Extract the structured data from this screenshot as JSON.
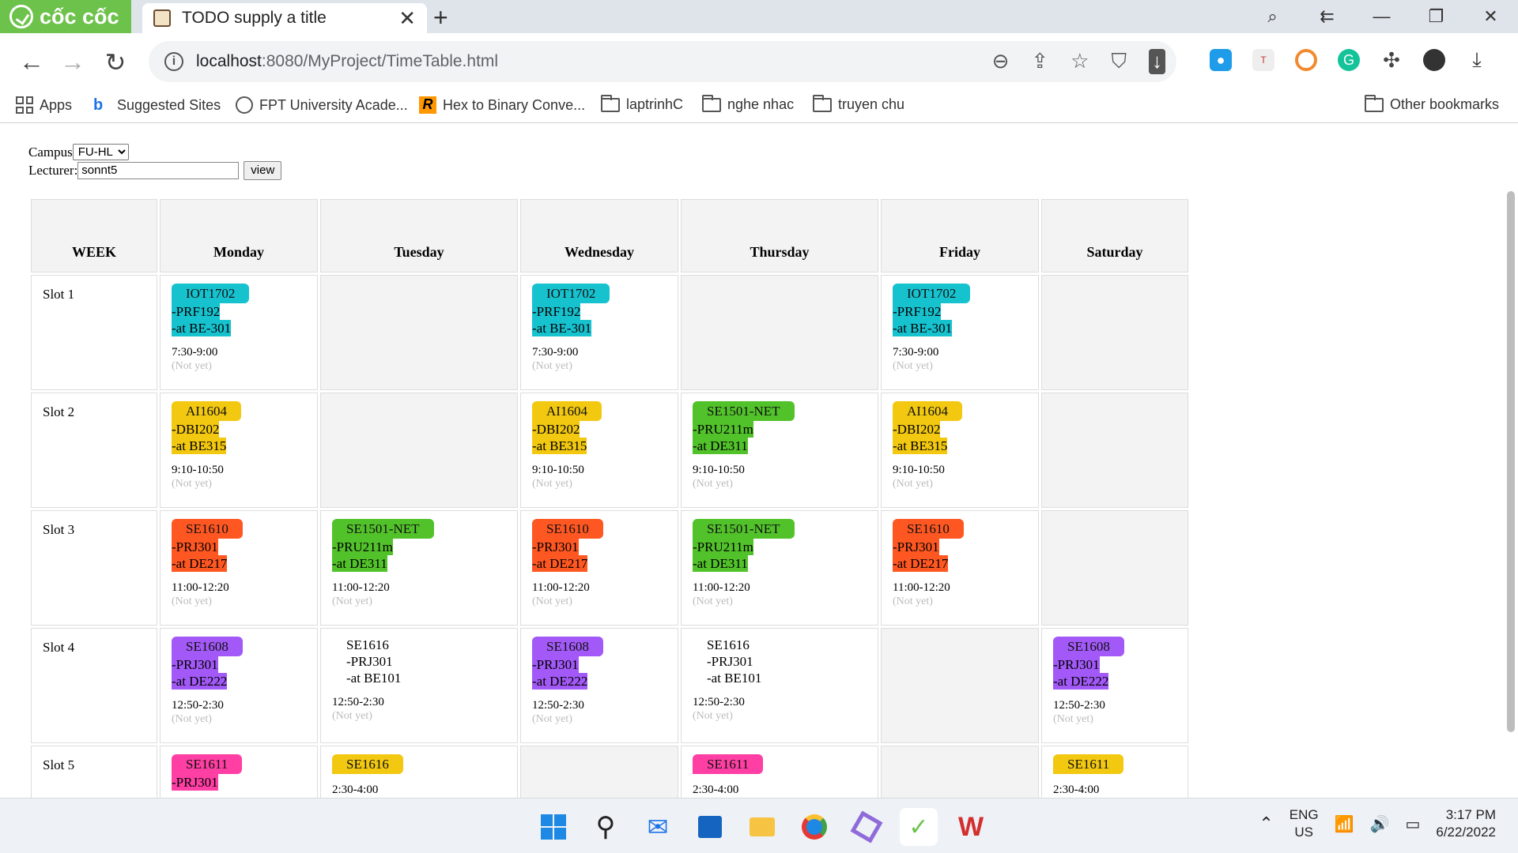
{
  "browser": {
    "brand": "cốc cốc",
    "tab_title": "TODO supply a title",
    "url_host": "localhost",
    "url_path": ":8080/MyProject/TimeTable.html"
  },
  "bookmarks": [
    {
      "label": "Apps",
      "icon": "apps-grid-icon"
    },
    {
      "label": "Suggested Sites",
      "icon": "bing-icon"
    },
    {
      "label": "FPT University Acade...",
      "icon": "globe-icon"
    },
    {
      "label": "Hex to Binary Conve...",
      "icon": "r-logo-icon"
    },
    {
      "label": "laptrinhC",
      "icon": "folder-icon"
    },
    {
      "label": "nghe nhac",
      "icon": "folder-icon"
    },
    {
      "label": "truyen chu",
      "icon": "folder-icon"
    },
    {
      "label": "Other bookmarks",
      "icon": "folder-icon"
    }
  ],
  "form": {
    "campus_label": "Campus",
    "campus_value": "FU-HL",
    "lecturer_label": "Lecturer:",
    "lecturer_value": "sonnt5",
    "view_label": "view"
  },
  "timetable": {
    "headers": [
      "WEEK",
      "Monday",
      "Tuesday",
      "Wednesday",
      "Thursday",
      "Friday",
      "Saturday"
    ],
    "slots": [
      {
        "label": "Slot 1",
        "time": "7:30-9:00",
        "cells": [
          {
            "class": "IOT1702",
            "course": "-PRF192",
            "room": "-at BE-301",
            "color": "#17c2cf",
            "status": "(Not yet)"
          },
          null,
          {
            "class": "IOT1702",
            "course": "-PRF192",
            "room": "-at BE-301",
            "color": "#17c2cf",
            "status": "(Not yet)"
          },
          null,
          {
            "class": "IOT1702",
            "course": "-PRF192",
            "room": "-at BE-301",
            "color": "#17c2cf",
            "status": "(Not yet)"
          },
          null
        ]
      },
      {
        "label": "Slot 2",
        "time": "9:10-10:50",
        "cells": [
          {
            "class": "AI1604",
            "course": "-DBI202",
            "room": "-at BE315",
            "color": "#f2c811",
            "status": "(Not yet)"
          },
          null,
          {
            "class": "AI1604",
            "course": "-DBI202",
            "room": "-at BE315",
            "color": "#f2c811",
            "status": "(Not yet)"
          },
          {
            "class": "SE1501-NET",
            "course": "-PRU211m",
            "room": "-at DE311",
            "color": "#52c22b",
            "status": "(Not yet)"
          },
          {
            "class": "AI1604",
            "course": "-DBI202",
            "room": "-at BE315",
            "color": "#f2c811",
            "status": "(Not yet)"
          },
          null
        ]
      },
      {
        "label": "Slot 3",
        "time": "11:00-12:20",
        "cells": [
          {
            "class": "SE1610",
            "course": "-PRJ301",
            "room": "-at DE217",
            "color": "#ff5722",
            "status": "(Not yet)"
          },
          {
            "class": "SE1501-NET",
            "course": "-PRU211m",
            "room": "-at DE311",
            "color": "#52c22b",
            "status": "(Not yet)"
          },
          {
            "class": "SE1610",
            "course": "-PRJ301",
            "room": "-at DE217",
            "color": "#ff5722",
            "status": "(Not yet)"
          },
          {
            "class": "SE1501-NET",
            "course": "-PRU211m",
            "room": "-at DE311",
            "color": "#52c22b",
            "status": "(Not yet)"
          },
          {
            "class": "SE1610",
            "course": "-PRJ301",
            "room": "-at DE217",
            "color": "#ff5722",
            "status": "(Not yet)"
          },
          null
        ]
      },
      {
        "label": "Slot 4",
        "time": "12:50-2:30",
        "cells": [
          {
            "class": "SE1608",
            "course": "-PRJ301",
            "room": "-at DE222",
            "color": "#a259f7",
            "status": "(Not yet)"
          },
          {
            "class": "SE1616",
            "course": "-PRJ301",
            "room": "-at BE101",
            "color": "",
            "status": "(Not yet)"
          },
          {
            "class": "SE1608",
            "course": "-PRJ301",
            "room": "-at DE222",
            "color": "#a259f7",
            "status": "(Not yet)"
          },
          {
            "class": "SE1616",
            "course": "-PRJ301",
            "room": "-at BE101",
            "color": "",
            "status": "(Not yet)"
          },
          null,
          {
            "class": "SE1608",
            "course": "-PRJ301",
            "room": "-at DE222",
            "color": "#a259f7",
            "status": "(Not yet)"
          }
        ]
      },
      {
        "label": "Slot 5",
        "time": "2:30-4:00",
        "cells": [
          {
            "class": "SE1611",
            "course": "-PRJ301",
            "room": "",
            "color": "#ff3fa4",
            "status": ""
          },
          {
            "class": "SE1616",
            "course": "",
            "room": "",
            "color": "#f2c811",
            "status": "",
            "time": "2:30-4:00"
          },
          null,
          {
            "class": "SE1611",
            "course": "",
            "room": "",
            "color": "#ff3fa4",
            "status": "",
            "time": "2:30-4:00"
          },
          null,
          {
            "class": "SE1611",
            "course": "",
            "room": "",
            "color": "#f2c811",
            "status": "",
            "time": "2:30-4:00"
          }
        ]
      }
    ]
  },
  "taskbar": {
    "lang_top": "ENG",
    "lang_bottom": "US",
    "time": "3:17 PM",
    "date": "6/22/2022"
  }
}
